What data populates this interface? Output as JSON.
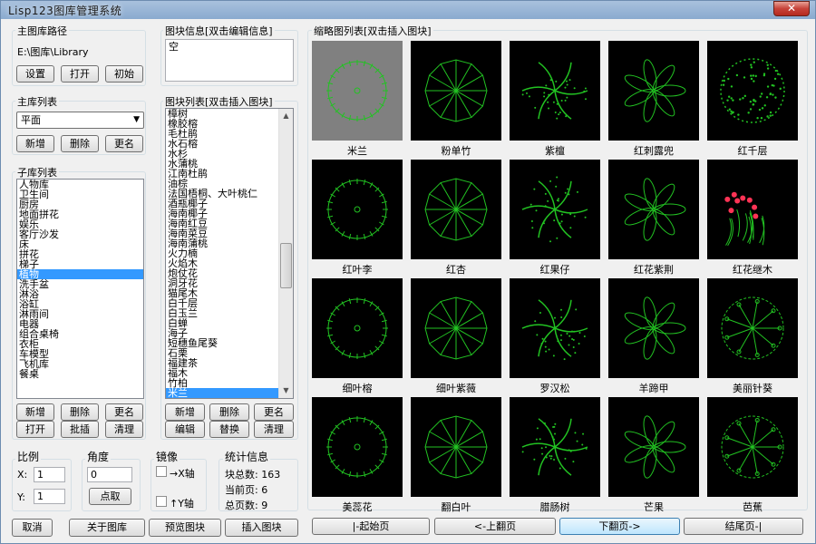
{
  "window": {
    "title": "Lisp123图库管理系统",
    "close_label": "✕"
  },
  "main_path": {
    "group_label": "主图库路径",
    "path": "E:\\图库\\Library",
    "buttons": [
      "设置",
      "打开",
      "初始"
    ]
  },
  "block_info": {
    "group_label": "图块信息[双击编辑信息]",
    "value": "空"
  },
  "main_list": {
    "group_label": "主库列表",
    "selected": "平面",
    "buttons": [
      "新增",
      "删除",
      "更名"
    ]
  },
  "sub_list": {
    "group_label": "子库列表",
    "items": [
      "人物库",
      "卫生间",
      "厨房",
      "地面拼花",
      "娱乐",
      "客厅沙发",
      "床",
      "拼花",
      "梯子",
      "植物",
      "洗手盆",
      "淋浴",
      "浴缸",
      "淋雨间",
      "电器",
      "组合桌椅",
      "衣柜",
      "车模型",
      "飞机库",
      "餐桌"
    ],
    "selected_index": 9,
    "buttons": [
      "新增",
      "删除",
      "更名",
      "打开",
      "批插",
      "清理"
    ]
  },
  "block_list": {
    "group_label": "图块列表[双击插入图块]",
    "items": [
      "樟树",
      "橡胶榕",
      "毛杜鹃",
      "水石榕",
      "水杉",
      "水蒲桃",
      "江南杜鹃",
      "油棕",
      "法国梧桐、大叶桃仁",
      "酒瓶椰子",
      "海南椰子",
      "海南红豆",
      "海南菜豆",
      "海南蒲桃",
      "火力楠",
      "火焰木",
      "炮仗花",
      "洞牙花",
      "猫尾木",
      "白千层",
      "白玉兰",
      "白蝉",
      "海子",
      "短穗鱼尾葵",
      "石栗",
      "福建茶",
      "福木",
      "竹柏",
      "米兰"
    ],
    "selected_index": 28,
    "buttons": [
      "新增",
      "删除",
      "更名",
      "编辑",
      "替换",
      "清理"
    ]
  },
  "scale": {
    "group_label": "比例",
    "x_label": "X:",
    "x_value": "1",
    "y_label": "Y:",
    "y_value": "1"
  },
  "angle": {
    "group_label": "角度",
    "value": "0",
    "pick_label": "点取"
  },
  "mirror": {
    "group_label": "镜像",
    "x_label": "→X轴",
    "y_label": "↑Y轴"
  },
  "stats": {
    "group_label": "统计信息",
    "lines": [
      "块总数: 163",
      "当前页: 6",
      "总页数: 9"
    ]
  },
  "bottom_buttons": [
    "取消",
    "关于图库",
    "预览图块",
    "插入图块"
  ],
  "thumbs": {
    "group_label": "缩略图列表[双击插入图块]",
    "items": [
      "米兰",
      "粉单竹",
      "紫檀",
      "红刺露兜",
      "红千层",
      "红叶李",
      "红杏",
      "红果仔",
      "红花紫荆",
      "红花继木",
      "细叶榕",
      "细叶紫薇",
      "罗汉松",
      "羊蹄甲",
      "美丽针葵",
      "美蕊花",
      "翻白叶",
      "腊肠树",
      "芒果",
      "芭蕉"
    ],
    "selected_index": 0,
    "line_color": "#22c222",
    "accent_color": "#ff3355"
  },
  "pager": [
    "|-起始页",
    "<-上翻页",
    "下翻页->",
    "结尾页-|"
  ]
}
